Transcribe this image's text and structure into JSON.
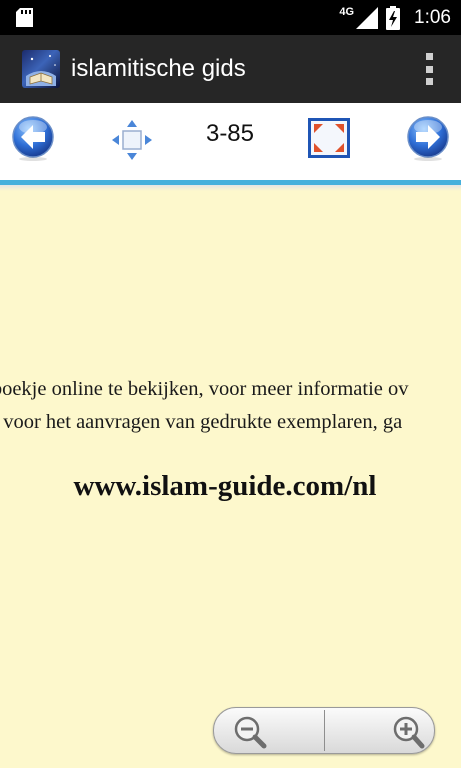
{
  "status_bar": {
    "network_type": "4G",
    "time": "1:06"
  },
  "action_bar": {
    "title": "islamitische gids"
  },
  "toolbar": {
    "page_indicator": "3-85"
  },
  "document": {
    "line_1": "t boekje online te bekijken, voor meer informatie ov",
    "line_2": "of voor het aanvragen van gedrukte exemplaren, ga",
    "url": "www.islam-guide.com/nl"
  },
  "colors": {
    "status_bar": "#000000",
    "action_bar": "#262626",
    "toolbar_accent": "#45b0dc",
    "page_background": "#fdf8cc"
  }
}
